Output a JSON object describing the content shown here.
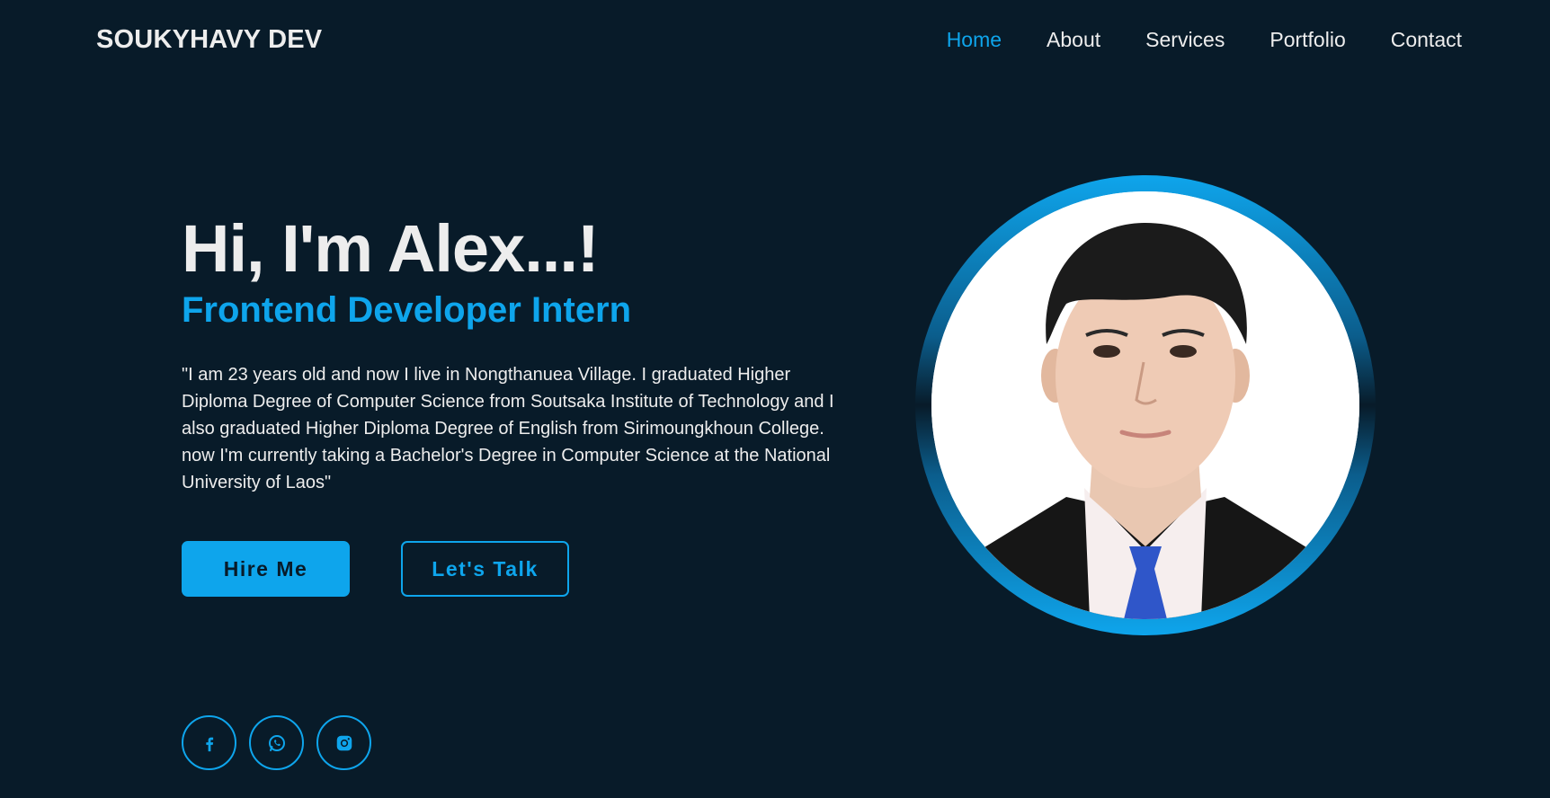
{
  "header": {
    "logo": "SOUKYHAVY DEV",
    "nav": [
      {
        "label": "Home",
        "active": true
      },
      {
        "label": "About",
        "active": false
      },
      {
        "label": "Services",
        "active": false
      },
      {
        "label": "Portfolio",
        "active": false
      },
      {
        "label": "Contact",
        "active": false
      }
    ]
  },
  "hero": {
    "title": "Hi, I'm Alex...!",
    "role": "Frontend Developer Intern",
    "bio": "\"I am 23 years old and now I live in Nongthanuea Village. I graduated Higher Diploma Degree of Computer Science from Soutsaka Institute of Technology and I also graduated Higher Diploma Degree of English from Sirimoungkhoun College. now I'm currently taking a Bachelor's Degree in Computer Science at the National University of Laos\"",
    "hire_label": "Hire Me",
    "talk_label": "Let's Talk"
  },
  "social": [
    {
      "icon": "facebook-icon"
    },
    {
      "icon": "whatsapp-icon"
    },
    {
      "icon": "instagram-icon"
    }
  ],
  "colors": {
    "background": "#081b29",
    "accent": "#0ea5ec",
    "text": "#ededed"
  }
}
